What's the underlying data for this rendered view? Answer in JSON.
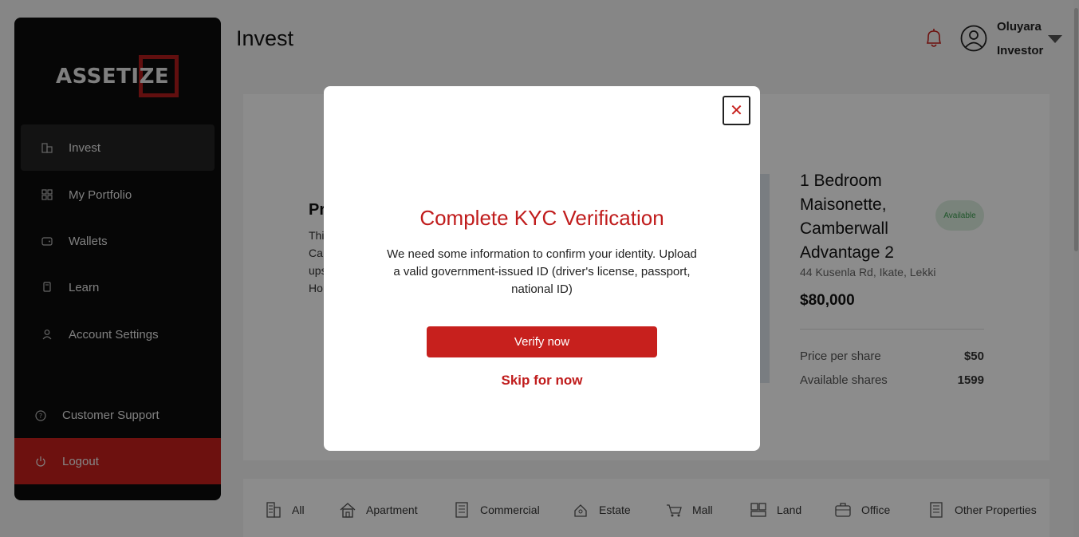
{
  "page_title": "Invest",
  "brand": {
    "logo_text": "ASSETIZE",
    "accent_color": "#c7201d"
  },
  "header": {
    "user_name": "Oluyara",
    "user_role": "Investor",
    "icons": [
      "bell-icon",
      "user-avatar-icon",
      "caret-down-icon"
    ]
  },
  "sidebar": {
    "items": [
      {
        "label": "Invest",
        "icon": "building-icon",
        "active": true
      },
      {
        "label": "My Portfolio",
        "icon": "portfolio-icon",
        "active": false
      },
      {
        "label": "Wallets",
        "icon": "wallet-icon",
        "active": false
      },
      {
        "label": "Learn",
        "icon": "book-icon",
        "active": false
      },
      {
        "label": "Account Settings",
        "icon": "user-icon",
        "active": false
      }
    ],
    "support_label": "Customer Support",
    "logout_label": "Logout"
  },
  "featured": {
    "left_title": "Pr",
    "left_lines": [
      "Thi",
      "Ca",
      "ups",
      "Ho"
    ],
    "property": {
      "title": "1 Bedroom Maisonette, Camberwall Advantage 2",
      "status": "Available",
      "address": "44 Kusenla Rd, Ikate, Lekki",
      "price": "$80,000",
      "price_per_share_label": "Price per share",
      "price_per_share": "$50",
      "available_shares_label": "Available shares",
      "available_shares": "1599"
    }
  },
  "categories": [
    {
      "label": "All",
      "icon": "all-buildings-icon"
    },
    {
      "label": "Apartment",
      "icon": "house-icon"
    },
    {
      "label": "Commercial",
      "icon": "commercial-building-icon"
    },
    {
      "label": "Estate",
      "icon": "estate-icon"
    },
    {
      "label": "Mall",
      "icon": "mall-icon"
    },
    {
      "label": "Land",
      "icon": "land-icon"
    },
    {
      "label": "Office",
      "icon": "briefcase-icon"
    },
    {
      "label": "Other Properties",
      "icon": "other-building-icon"
    }
  ],
  "modal": {
    "title": "Complete KYC Verification",
    "body": "We need some information to confirm your identity. Upload a valid government-issued ID (driver's license, passport, national ID)",
    "primary_button": "Verify now",
    "secondary_link": "Skip for now",
    "close_symbol": "✕"
  }
}
